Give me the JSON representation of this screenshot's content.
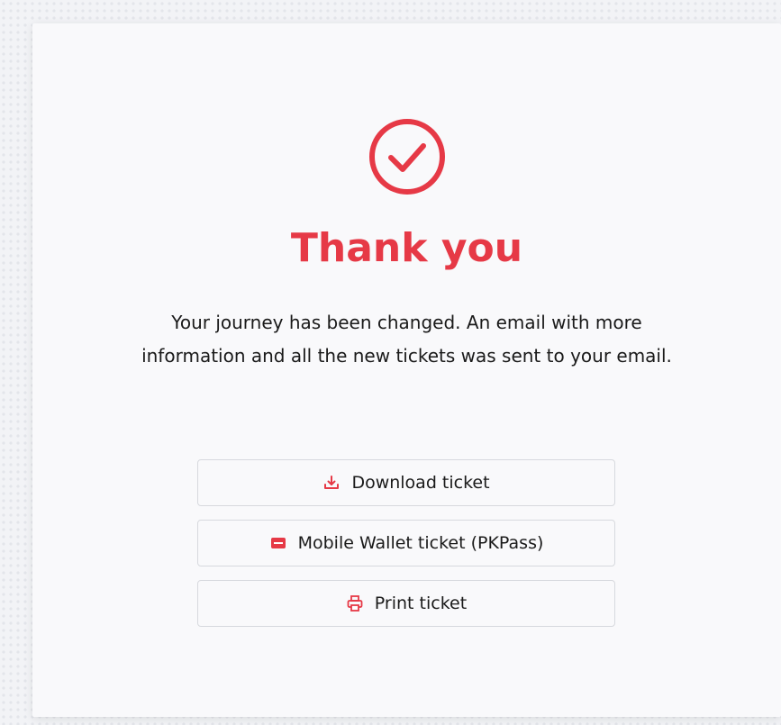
{
  "confirmation": {
    "title": "Thank you",
    "message": "Your journey has been changed. An email with more information and all the new tickets was sent to your email.",
    "icon": "check-circle-icon"
  },
  "actions": {
    "download_label": "Download ticket",
    "download_icon": "download-icon",
    "wallet_label": "Mobile Wallet ticket (PKPass)",
    "wallet_icon": "wallet-icon",
    "print_label": "Print ticket",
    "print_icon": "printer-icon"
  },
  "colors": {
    "accent": "#e63946",
    "text": "#1a1a1a",
    "card_background": "#f9f9fb",
    "button_border": "#d7d9de"
  }
}
